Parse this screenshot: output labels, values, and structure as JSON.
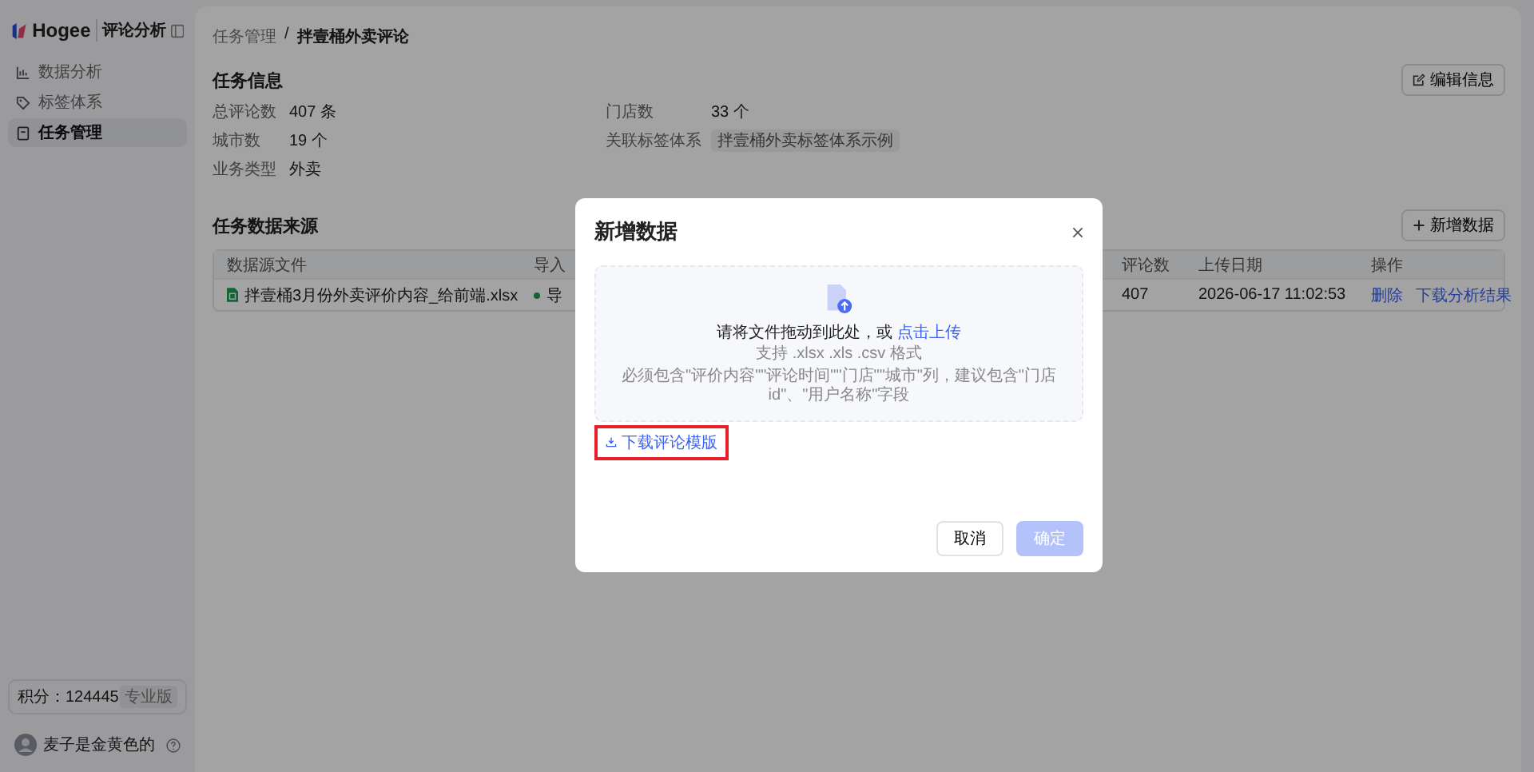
{
  "sidebar": {
    "logo": "Hogee",
    "product": "评论分析",
    "items": [
      {
        "label": "数据分析",
        "selected": false
      },
      {
        "label": "标签体系",
        "selected": false
      },
      {
        "label": "任务管理",
        "selected": true
      }
    ],
    "points": {
      "label": "积分：124445",
      "badge": "专业版"
    },
    "user": {
      "name": "麦子是金黄色的"
    }
  },
  "breadcrumb": {
    "parent": "任务管理",
    "separator": "/",
    "current": "拌壹桶外卖评论"
  },
  "task_info": {
    "title": "任务信息",
    "edit_button": "编辑信息",
    "fields": [
      {
        "label": "总评论数",
        "value": "407 条",
        "kind": "text"
      },
      {
        "label": "门店数",
        "value": "33 个",
        "kind": "text"
      },
      {
        "label": "城市数",
        "value": "19 个",
        "kind": "text"
      },
      {
        "label": "关联标签体系",
        "value": "拌壹桶外卖标签体系示例",
        "kind": "tag"
      },
      {
        "label": "业务类型",
        "value": "外卖",
        "kind": "text"
      }
    ]
  },
  "data_sources": {
    "title": "任务数据来源",
    "add_button": "新增数据",
    "table": {
      "columns": [
        "数据源文件",
        "导入",
        "评论数",
        "上传日期",
        "操作"
      ],
      "rows": [
        {
          "file": "拌壹桶3月份外卖评价内容_给前端.xlsx",
          "status": "导",
          "count": "407",
          "date": "2026-06-17 11:02:53",
          "actions": [
            "删除",
            "下载分析结果"
          ]
        }
      ]
    }
  },
  "modal": {
    "title": "新增数据",
    "dropzone": {
      "prompt": "请将文件拖动到此处，或",
      "link": "点击上传",
      "formats": "支持 .xlsx .xls .csv 格式",
      "hint": "必须包含\"评价内容\"\"评论时间\"\"门店\"\"城市\"列，建议包含\"门店id\"、\"用户名称\"字段"
    },
    "template_link": {
      "label": "下载评论模版",
      "highlighted": true
    },
    "buttons": [
      {
        "label": "取消",
        "kind": "secondary",
        "disabled": false
      },
      {
        "label": "确定",
        "kind": "primary",
        "disabled": true
      }
    ]
  }
}
